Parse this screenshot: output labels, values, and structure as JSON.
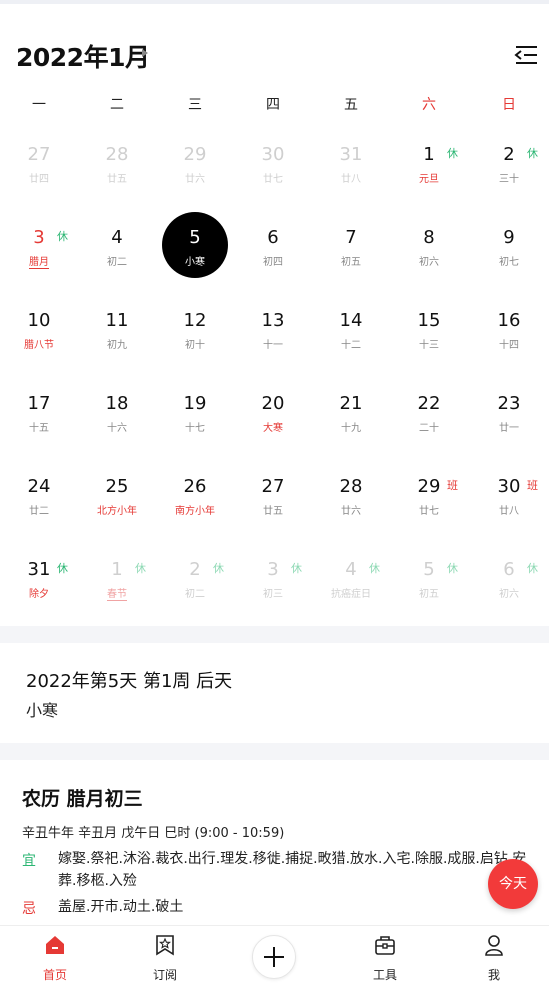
{
  "header": {
    "month_title": "2022年1月"
  },
  "weekdays": [
    "一",
    "二",
    "三",
    "四",
    "五",
    "六",
    "日"
  ],
  "weeks": [
    [
      {
        "day": "27",
        "sub": "廿四",
        "dim": true
      },
      {
        "day": "28",
        "sub": "廿五",
        "dim": true
      },
      {
        "day": "29",
        "sub": "廿六",
        "dim": true
      },
      {
        "day": "30",
        "sub": "廿七",
        "dim": true
      },
      {
        "day": "31",
        "sub": "廿八",
        "dim": true
      },
      {
        "day": "1",
        "sub": "元旦",
        "badge": "休",
        "sub_red": true
      },
      {
        "day": "2",
        "sub": "三十",
        "badge": "休"
      }
    ],
    [
      {
        "day": "3",
        "sub": "腊月",
        "badge": "休",
        "num_red": true,
        "sub_red": true,
        "underline": true
      },
      {
        "day": "4",
        "sub": "初二"
      },
      {
        "day": "5",
        "sub": "小寒",
        "selected": true
      },
      {
        "day": "6",
        "sub": "初四"
      },
      {
        "day": "7",
        "sub": "初五"
      },
      {
        "day": "8",
        "sub": "初六"
      },
      {
        "day": "9",
        "sub": "初七"
      }
    ],
    [
      {
        "day": "10",
        "sub": "腊八节",
        "sub_red": true
      },
      {
        "day": "11",
        "sub": "初九"
      },
      {
        "day": "12",
        "sub": "初十"
      },
      {
        "day": "13",
        "sub": "十一"
      },
      {
        "day": "14",
        "sub": "十二"
      },
      {
        "day": "15",
        "sub": "十三"
      },
      {
        "day": "16",
        "sub": "十四"
      }
    ],
    [
      {
        "day": "17",
        "sub": "十五"
      },
      {
        "day": "18",
        "sub": "十六"
      },
      {
        "day": "19",
        "sub": "十七"
      },
      {
        "day": "20",
        "sub": "大寒",
        "sub_red": true
      },
      {
        "day": "21",
        "sub": "十九"
      },
      {
        "day": "22",
        "sub": "二十"
      },
      {
        "day": "23",
        "sub": "廿一"
      }
    ],
    [
      {
        "day": "24",
        "sub": "廿二"
      },
      {
        "day": "25",
        "sub": "北方小年",
        "sub_red": true
      },
      {
        "day": "26",
        "sub": "南方小年",
        "sub_red": true
      },
      {
        "day": "27",
        "sub": "廿五"
      },
      {
        "day": "28",
        "sub": "廿六"
      },
      {
        "day": "29",
        "sub": "廿七",
        "badge": "班"
      },
      {
        "day": "30",
        "sub": "廿八",
        "badge": "班"
      }
    ],
    [
      {
        "day": "31",
        "sub": "除夕",
        "badge": "休",
        "sub_red": true
      },
      {
        "day": "1",
        "sub": "春节",
        "badge": "休",
        "dim": true,
        "sub_red": true,
        "underline": true
      },
      {
        "day": "2",
        "sub": "初二",
        "badge": "休",
        "dim": true
      },
      {
        "day": "3",
        "sub": "初三",
        "badge": "休",
        "dim": true
      },
      {
        "day": "4",
        "sub": "抗癌症日",
        "badge": "休",
        "dim": true
      },
      {
        "day": "5",
        "sub": "初五",
        "badge": "休",
        "dim": true
      },
      {
        "day": "6",
        "sub": "初六",
        "badge": "休",
        "dim": true
      }
    ]
  ],
  "info": {
    "line1": "2022年第5天 第1周 后天",
    "line2": "小寒"
  },
  "huangli": {
    "title": "农历 腊月初三",
    "ganzhi": "辛丑牛年 辛丑月 戊午日 巳时 (9:00 - 10:59)",
    "yi_label": "宜",
    "yi_text": "嫁娶.祭祀.沐浴.裁衣.出行.理发.移徙.捕捉.畋猎.放水.入宅.除服.成服.启钻.安葬.移柩.入殓",
    "ji_label": "忌",
    "ji_text": "盖屋.开市.动土.破土"
  },
  "today_button": "今天",
  "nav": [
    {
      "label": "首页",
      "icon": "home-icon",
      "active": true
    },
    {
      "label": "订阅",
      "icon": "bookmark-star-icon"
    },
    {
      "label": "",
      "icon": "plus-icon"
    },
    {
      "label": "工具",
      "icon": "toolbox-icon"
    },
    {
      "label": "我",
      "icon": "user-icon"
    }
  ],
  "colors": {
    "accent": "#e53935",
    "rest": "#2bb673",
    "selected": "#000000"
  }
}
